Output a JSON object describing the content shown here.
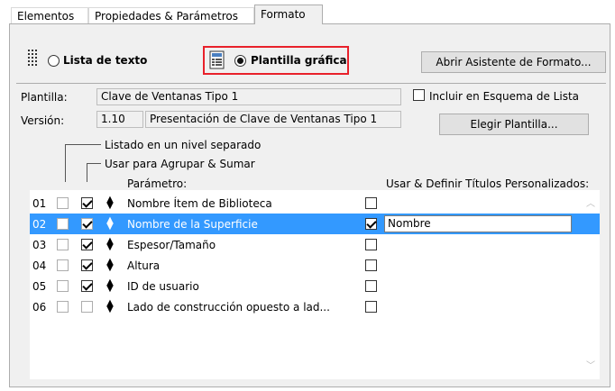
{
  "tabs": [
    {
      "label": "Elementos"
    },
    {
      "label": "Propiedades & Parámetros"
    },
    {
      "label": "Formato"
    }
  ],
  "format_mode": {
    "text_list_label": "Lista de texto",
    "graphic_template_label": "Plantilla gráfica",
    "selected": "graphic_template"
  },
  "wizard_button": "Abrir Asistente de Formato...",
  "template": {
    "label": "Plantilla:",
    "value": "Clave de Ventanas Tipo 1",
    "version_label": "Versión:",
    "version_value": "1.10",
    "description": "Presentación de Clave de Ventanas Tipo 1",
    "include_label": "Incluir en Esquema de Lista",
    "include_checked": false,
    "choose_button": "Elegir Plantilla..."
  },
  "column_headers": {
    "separate_level": "Listado en un nivel separado",
    "group_sum": "Usar para Agrupar & Sumar",
    "parameter": "Parámetro:",
    "custom_titles": "Usar & Definir Títulos Personalizados:"
  },
  "rows": [
    {
      "num": "01",
      "separate": false,
      "group": true,
      "param": "Nombre Ítem de Biblioteca",
      "custom": false,
      "title": ""
    },
    {
      "num": "02",
      "separate": false,
      "group": true,
      "param": "Nombre de la Superficie",
      "custom": true,
      "title": "Nombre",
      "selected": true
    },
    {
      "num": "03",
      "separate": false,
      "group": true,
      "param": "Espesor/Tamaño",
      "custom": false,
      "title": ""
    },
    {
      "num": "04",
      "separate": false,
      "group": true,
      "param": "Altura",
      "custom": false,
      "title": ""
    },
    {
      "num": "05",
      "separate": false,
      "group": true,
      "param": "ID de usuario",
      "custom": false,
      "title": ""
    },
    {
      "num": "06",
      "separate": false,
      "group": false,
      "param": "Lado de construcción opuesto a lad...",
      "custom": false,
      "title": ""
    }
  ],
  "colors": {
    "selection": "#3399ff",
    "highlight_border": "#e8212b"
  }
}
